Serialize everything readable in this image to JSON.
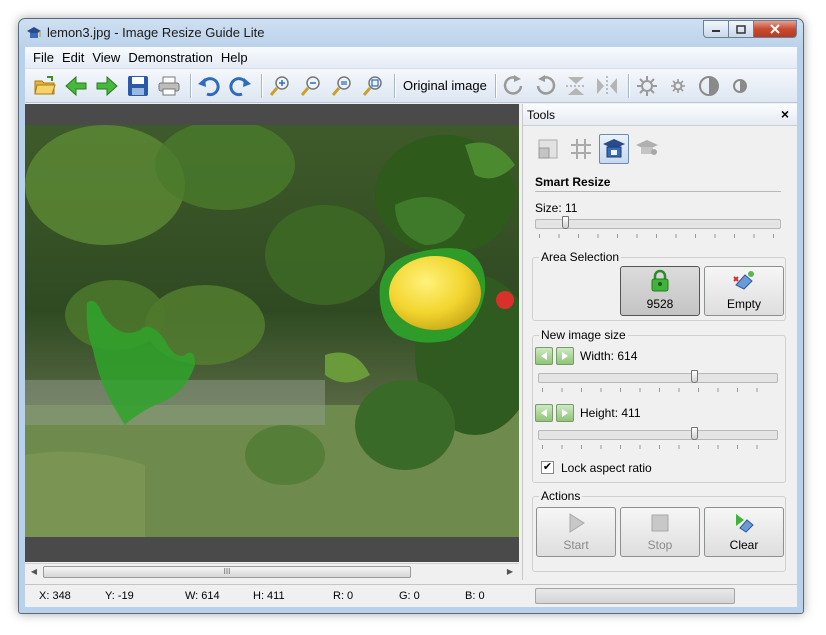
{
  "window": {
    "title": "lemon3.jpg - Image Resize Guide Lite"
  },
  "menu": [
    "File",
    "Edit",
    "View",
    "Demonstration",
    "Help"
  ],
  "toolbar": {
    "icons": [
      "open-folder-icon",
      "back-arrow-icon",
      "forward-arrow-icon",
      "save-icon",
      "print-icon",
      "undo-icon",
      "redo-icon",
      "zoom-in-icon",
      "zoom-out-icon",
      "zoom-fit-icon",
      "zoom-actual-icon",
      "rotate-right-icon",
      "rotate-left-icon",
      "flip-vertical-icon",
      "flip-horizontal-icon",
      "brightness-up-icon",
      "brightness-down-icon",
      "contrast-up-icon",
      "contrast-down-icon"
    ],
    "original_image_label": "Original image"
  },
  "tools": {
    "title": "Tools",
    "close_glyph": "×",
    "section_title": "Smart Resize",
    "size_label": "Size: 11",
    "size_value": 11,
    "size_range": [
      0,
      100
    ],
    "area_selection": {
      "title": "Area Selection",
      "lock_count": "9528",
      "empty_label": "Empty"
    },
    "new_size": {
      "title": "New image size",
      "width_label": "Width: 614",
      "width_fraction": 0.66,
      "height_label": "Height: 411",
      "height_fraction": 0.66,
      "lock_aspect_label": "Lock aspect ratio",
      "lock_aspect_checked": true
    },
    "actions": {
      "title": "Actions",
      "start_label": "Start",
      "stop_label": "Stop",
      "clear_label": "Clear"
    }
  },
  "scrollbar": {
    "thumb_glyph": "III"
  },
  "status": {
    "x": "X: 348",
    "y": "Y: -19",
    "w": "W: 614",
    "h": "H: 411",
    "r": "R: 0",
    "g": "G: 0",
    "b": "B: 0"
  },
  "colors": {
    "selection_green": "#2fa32a",
    "accent_blue": "#6c8bb1"
  }
}
